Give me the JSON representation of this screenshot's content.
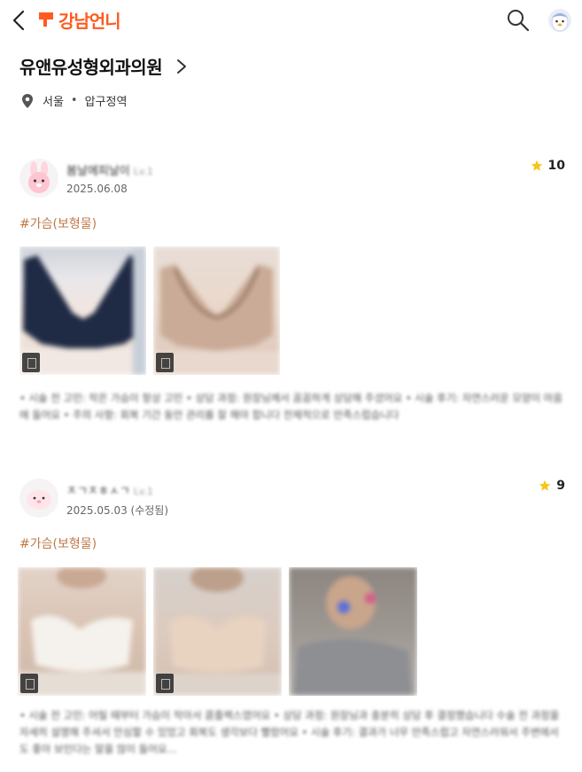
{
  "header": {
    "logo_text": "강남언니",
    "brand_color": "#ff5a1f",
    "back_icon": "chevron-left-icon",
    "search_icon": "search-icon",
    "profile_icon": "penguin-avatar-icon"
  },
  "hospital": {
    "name": "유앤유성형외과의원",
    "region": "서울",
    "separator": "•",
    "area": "압구정역",
    "location_icon": "map-pin-icon"
  },
  "reviews": [
    {
      "reviewer": "봄날에피날이",
      "level": "Lv.1",
      "date": "2025.06.08",
      "rating": "10",
      "tag": "#가슴(보형물)",
      "text": "• 시술 전 고민: 작은 가슴이 항상 고민 • 상담 과정: 원장님께서 꼼꼼하게 상담해 주셨어요 • 시술 후기: 자연스러운 모양이 마음에 들어요 • 주의 사항: 회복 기간 동안 관리를 잘 해야 합니다 전체적으로 만족스럽습니다"
    },
    {
      "reviewer": "ㅈㄱㅈㅎㅅㄱ",
      "level": "Lv.1",
      "date": "2025.05.03 (수정됨)",
      "rating": "9",
      "tag": "#가슴(보형물)",
      "text": "• 시술 전 고민: 어릴 때부터 가슴이 작아서 콤플렉스였어요 • 상담 과정: 원장님과 충분히 상담 후 결정했습니다 수술 전 과정을 자세히 설명해 주셔서 안심할 수 있었고 회복도 생각보다 빨랐어요 • 시술 후기: 결과가 너무 만족스럽고 자연스러워서 주변에서도 좋아 보인다는 말을 많이 들어요..."
    }
  ],
  "colors": {
    "tag": "#c07a4a",
    "star": "#f5c518"
  }
}
